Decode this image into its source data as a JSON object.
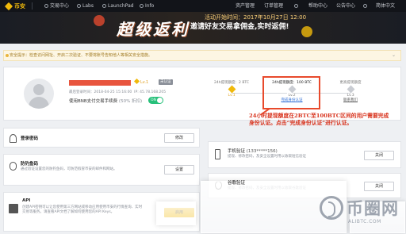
{
  "nav": {
    "logo": "币安",
    "items": [
      "交易中心",
      "Labs",
      "LaunchPad",
      "Info"
    ],
    "right_items": [
      "资产管理",
      "订单管理",
      "",
      "帮助中心",
      "公告中心"
    ],
    "language": "简体中文"
  },
  "banner": {
    "headline": "超级返利",
    "line1": "活动开始时间：2017年10月27日 12:00",
    "line2": "邀请好友交易拿佣金,实时返佣!"
  },
  "notice": {
    "text": "安全提示：检查访问网址、开启二次验证、不要将账号告知他人等相关安全措施。"
  },
  "profile": {
    "lv_label": "Lv.1",
    "tag": "未认证",
    "last_login_label": "最后登录时间：",
    "last_login_value": "2018-04-25 15:16:00",
    "ip_label": "IP:",
    "ip_value": "45.78.168.205",
    "bnb_label": "使用BNB支付交易手续费",
    "bnb_discount": "(50% 折扣)",
    "toggle_label": "ON",
    "levels": [
      {
        "limit": "24h提现额度：2 BTC",
        "level": "Lv.1",
        "action": ""
      },
      {
        "limit": "24h提现额度：100 BTC",
        "level": "Lv.2",
        "action": "完成身份认证"
      },
      {
        "limit": "更高提现额度",
        "level": "Lv.3",
        "action": "联系我们"
      }
    ]
  },
  "sections": {
    "login_password": {
      "title": "登录密码",
      "button": "修改"
    },
    "fund_password": {
      "title": "防钓鱼码",
      "desc": "通过验证设置您的防钓鱼码，可防范假冒币安的邮件和网站。",
      "button": "设置"
    },
    "api": {
      "title": "API",
      "desc": "创建API密钥可以让您使用第三方网站或移动应用使用币安的行情查询、实时交易等服务。请查看API文档了解如何使用您的API Keys。",
      "button": "启用"
    },
    "sms": {
      "title": "手机验证",
      "phone": "(133*****156)",
      "desc": "提现、修改密码，及安全设置时用以收取短信验证",
      "button": "关闭"
    },
    "google": {
      "title": "谷歌验证",
      "desc": "提现、修改密码，及安全设置时用以收取谷歌验证",
      "button": "关闭"
    }
  },
  "annotation": {
    "text": "24小时提现额度在2BTC至100BTC区间的用户需要完成身份认证。点击“完成身份认证”进行认证。"
  },
  "watermark": {
    "text": "币圈网",
    "url": "ALIBTC.COM"
  },
  "colors": {
    "brand": "#f0b90b",
    "annotation": "#d8331d",
    "toggle": "#27c07a"
  }
}
